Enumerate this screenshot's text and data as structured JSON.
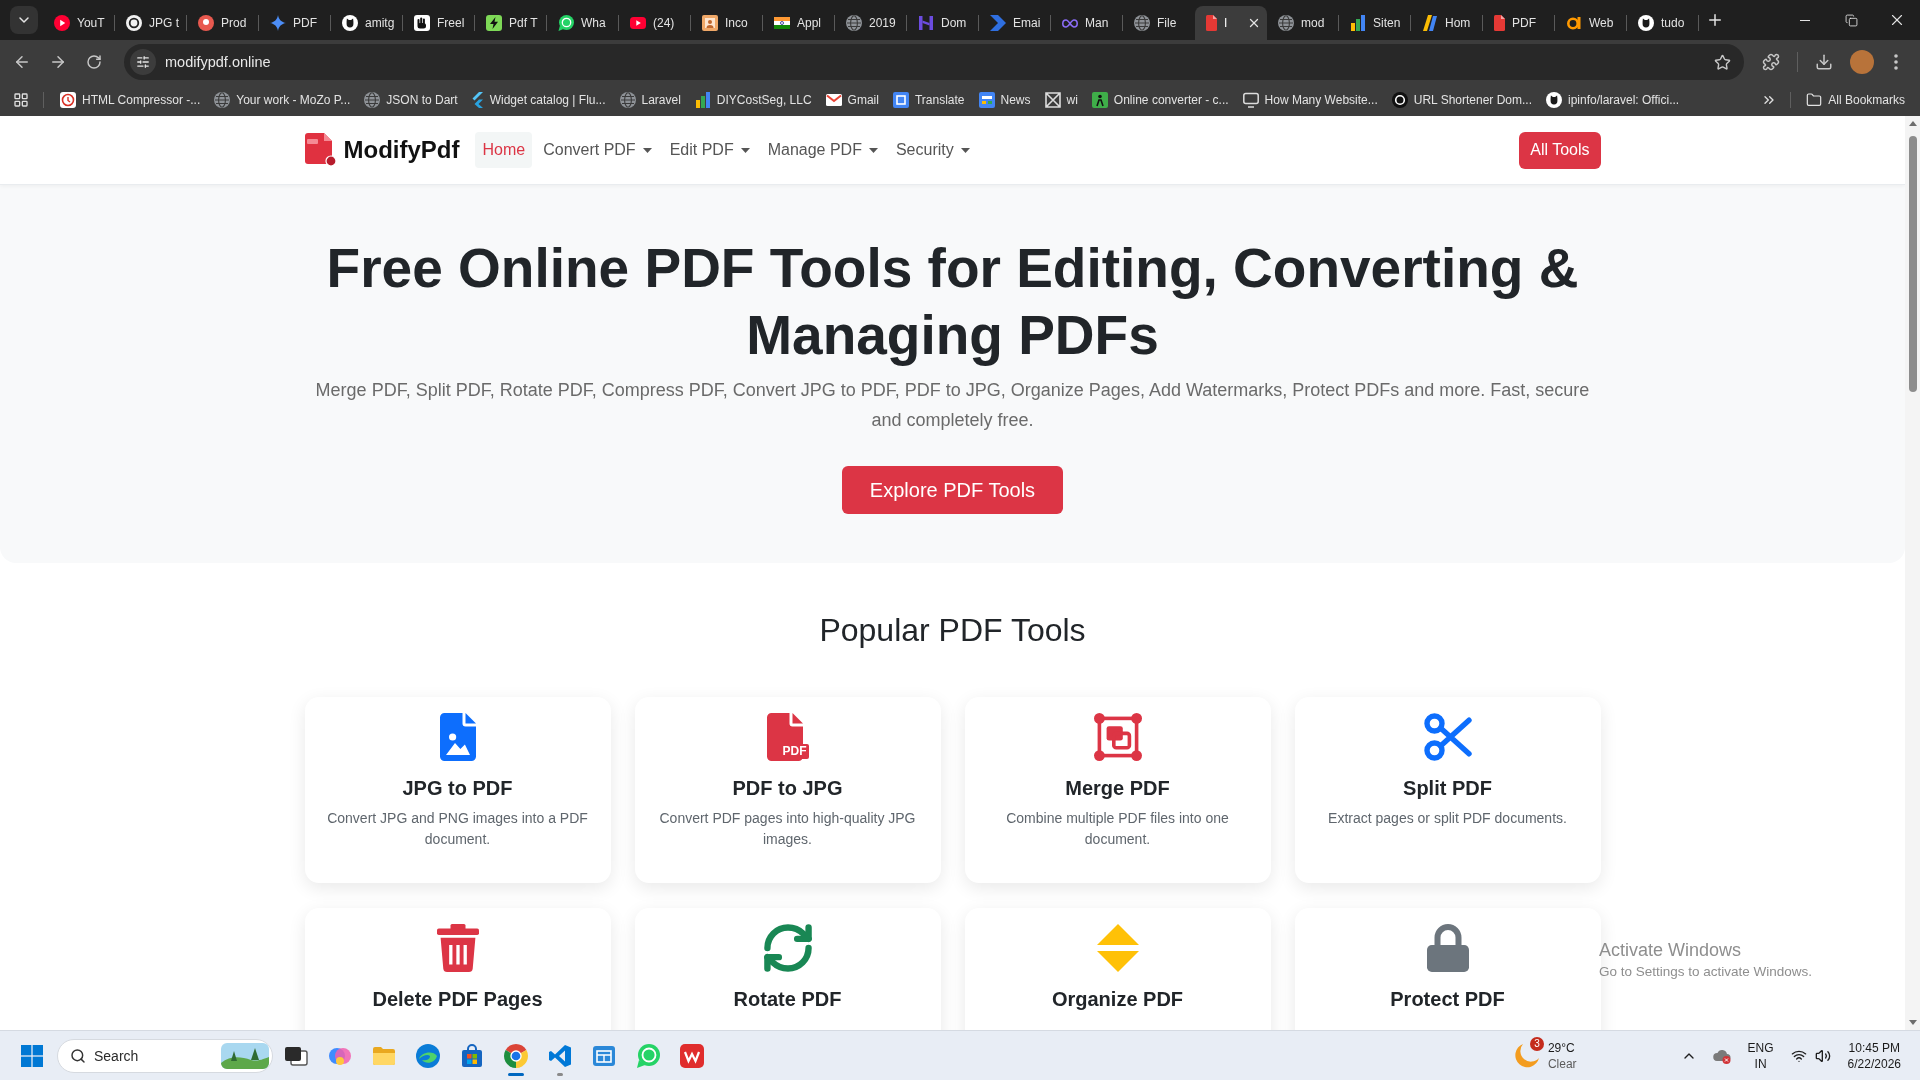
{
  "browser": {
    "tabs": [
      {
        "title": "YouT",
        "selected": false
      },
      {
        "title": "JPG t",
        "selected": false
      },
      {
        "title": "Prod",
        "selected": false
      },
      {
        "title": "PDF",
        "selected": false
      },
      {
        "title": "amitg",
        "selected": false
      },
      {
        "title": "Freel",
        "selected": false
      },
      {
        "title": "Pdf T",
        "selected": false
      },
      {
        "title": "Wha",
        "selected": false
      },
      {
        "title": "(24)",
        "selected": false
      },
      {
        "title": "Inco",
        "selected": false
      },
      {
        "title": "Appl",
        "selected": false
      },
      {
        "title": "2019",
        "selected": false
      },
      {
        "title": "Dom",
        "selected": false
      },
      {
        "title": "Emai",
        "selected": false
      },
      {
        "title": "Man",
        "selected": false
      },
      {
        "title": "File",
        "selected": false
      },
      {
        "title": "I",
        "selected": true
      },
      {
        "title": "mod",
        "selected": false
      },
      {
        "title": "Siten",
        "selected": false
      },
      {
        "title": "Hom",
        "selected": false
      },
      {
        "title": "PDF",
        "selected": false
      },
      {
        "title": "Web",
        "selected": false
      },
      {
        "title": "tudo",
        "selected": false
      }
    ],
    "url": "modifypdf.online",
    "bookmarks": [
      "HTML Compressor -...",
      "Your work - MoZo P...",
      "JSON to Dart",
      "Widget catalog | Flu...",
      "Laravel",
      "DIYCostSeg, LLC",
      "Gmail",
      "Translate",
      "News",
      "wi",
      "Online converter - c...",
      "How Many Website...",
      "URL Shortener Dom...",
      "ipinfo/laravel: Offici..."
    ],
    "all_bookmarks": "All Bookmarks"
  },
  "page": {
    "brand": "ModifyPdf",
    "nav": [
      {
        "label": "Home",
        "selected": true,
        "dropdown": false
      },
      {
        "label": "Convert PDF",
        "selected": false,
        "dropdown": true
      },
      {
        "label": "Edit PDF",
        "selected": false,
        "dropdown": true
      },
      {
        "label": "Manage PDF",
        "selected": false,
        "dropdown": true
      },
      {
        "label": "Security",
        "selected": false,
        "dropdown": true
      }
    ],
    "all_tools": "All Tools",
    "hero": {
      "title": "Free Online PDF Tools for Editing, Converting & Managing PDFs",
      "subtitle": "Merge PDF, Split PDF, Rotate PDF, Compress PDF, Convert JPG to PDF, PDF to JPG, Organize Pages, Add Watermarks, Protect PDFs and more. Fast, secure and completely free.",
      "button": "Explore PDF Tools"
    },
    "section_title": "Popular PDF Tools",
    "tools": [
      {
        "title": "JPG to PDF",
        "description": "Convert JPG and PNG images into a PDF document."
      },
      {
        "title": "PDF to JPG",
        "description": "Convert PDF pages into high-quality JPG images.",
        "icon_text": "PDF"
      },
      {
        "title": "Merge PDF",
        "description": "Combine multiple PDF files into one document."
      },
      {
        "title": "Split PDF",
        "description": "Extract pages or split PDF documents."
      },
      {
        "title": "Delete PDF Pages"
      },
      {
        "title": "Rotate PDF"
      },
      {
        "title": "Organize PDF"
      },
      {
        "title": "Protect PDF"
      }
    ]
  },
  "activation": {
    "title": "Activate Windows",
    "text": "Go to Settings to activate Windows."
  },
  "taskbar": {
    "search": {
      "placeholder": "Search"
    },
    "apps": [
      {
        "running": false,
        "active": false
      },
      {
        "running": false,
        "active": false
      },
      {
        "running": false,
        "active": false
      },
      {
        "running": false,
        "active": false
      },
      {
        "running": false,
        "active": false
      },
      {
        "running": true,
        "active": true
      },
      {
        "running": true,
        "active": false
      },
      {
        "running": false,
        "active": false
      },
      {
        "running": false,
        "active": false
      },
      {
        "running": false,
        "active": false
      }
    ],
    "weather": {
      "badge": "3",
      "temperature": "29°C",
      "condition": "Clear"
    },
    "language": "ENG",
    "region": "IN",
    "time": "10:45 PM",
    "date": "6/22/2026"
  }
}
